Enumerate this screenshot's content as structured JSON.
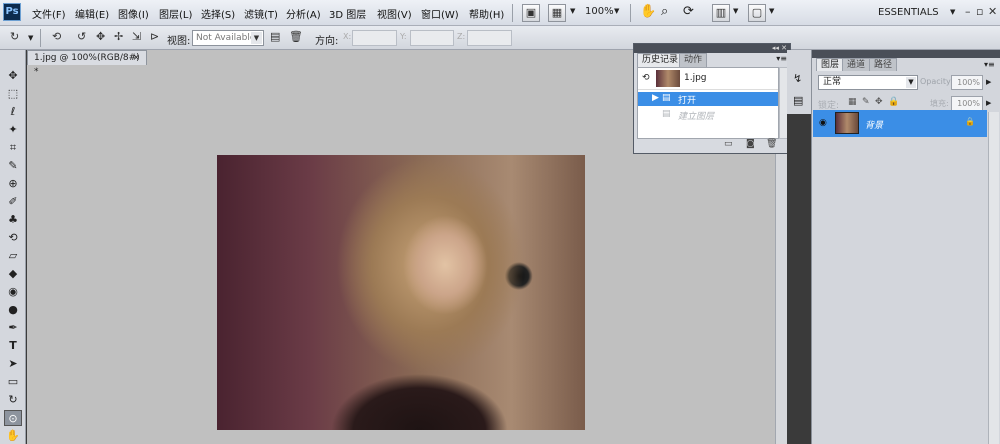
{
  "app": {
    "logo": "Ps"
  },
  "menu": [
    "文件(F)",
    "编辑(E)",
    "图像(I)",
    "图层(L)",
    "选择(S)",
    "滤镜(T)",
    "分析(A)",
    "3D 图层",
    "视图(V)",
    "窗口(W)",
    "帮助(H)"
  ],
  "menubar_tools": {
    "zoom_value": "100%",
    "workspace": "ESSENTIALS"
  },
  "options": {
    "view_label": "视图:",
    "view_value": "Not Available",
    "direction_label": "方向:",
    "coords": [
      "X:",
      "Y:",
      "Z:"
    ]
  },
  "document": {
    "tab_label": "1.jpg @ 100%(RGB/8#) *",
    "close_glyph": "×"
  },
  "history_panel": {
    "tabs": [
      "历史记录",
      "动作"
    ],
    "snapshot": "1.jpg",
    "states": [
      {
        "label": "打开",
        "selected": true
      },
      {
        "label": "建立图层",
        "selected": false
      }
    ],
    "accent": "#3b8ee6"
  },
  "layers_panel": {
    "tabs": [
      "图层",
      "通道",
      "路径"
    ],
    "blend_mode": "正常",
    "opacity_label": "Opacity:",
    "opacity": "100%",
    "lock_label": "锁定:",
    "fill_label": "填充:",
    "fill": "100%",
    "layer": {
      "name": "背景",
      "visible": true,
      "locked": true
    },
    "accent": "#3b8ee6"
  },
  "icons": {
    "move": "✥",
    "marquee": "⬚",
    "lasso": "ℓ",
    "wand": "✦",
    "crop": "⌗",
    "eyedropper": "✎",
    "healing": "⊕",
    "brush": "✐",
    "stamp": "♣",
    "history_brush": "⟲",
    "eraser": "▱",
    "bucket": "◆",
    "blur": "◉",
    "dodge": "●",
    "pen": "✒",
    "type": "T",
    "path_select": "➤",
    "shape": "▭",
    "3d": "↻",
    "orbit": "⊙",
    "hand": "✋",
    "zoom": "⌕"
  }
}
